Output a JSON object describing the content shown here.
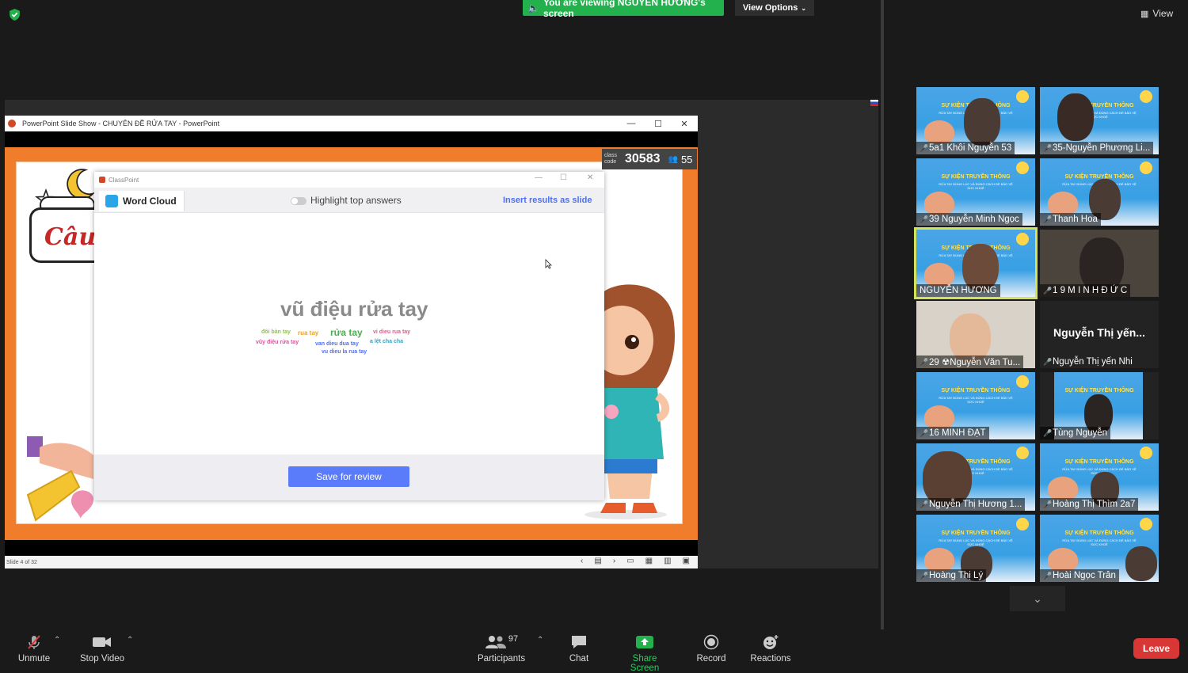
{
  "top": {
    "viewing_text": "You are viewing NGUYỄN HƯƠNG's screen",
    "view_options": "View Options",
    "view": "View"
  },
  "ppt": {
    "window_title": "PowerPoint Slide Show  -  CHUYÊN ĐỀ RỬA TAY - PowerPoint",
    "status": "Slide 4 of 32",
    "class_code_label": "class code",
    "class_code": "30583",
    "participants": "55",
    "slide_title": "Câu"
  },
  "classpoint": {
    "window_title": "ClassPoint",
    "tab": "Word Cloud",
    "highlight_label": "Highlight top answers",
    "insert_label": "Insert results as slide",
    "main_word": "vũ điệu rửa tay",
    "words": [
      {
        "text": "đôi bàn tay",
        "color": "#8cc63f"
      },
      {
        "text": "rua tay",
        "color": "#f0a020"
      },
      {
        "text": "rửa tay",
        "color": "#4caf50"
      },
      {
        "text": "vi dieu rua tay",
        "color": "#e05a8a"
      },
      {
        "text": "vũy điệu rửa tay",
        "color": "#d9539b"
      },
      {
        "text": "van dieu dua tay",
        "color": "#4d6ff5"
      },
      {
        "text": "a lệt cha cha",
        "color": "#2aa6c8"
      },
      {
        "text": "vu dieu la rua tay",
        "color": "#4d6ff5"
      }
    ],
    "save_label": "Save for review"
  },
  "gallery": [
    {
      "name": "5a1 Khôi Nguyễn 53",
      "type": "banner"
    },
    {
      "name": "35-Nguyễn Phương Li...",
      "type": "banner"
    },
    {
      "name": "39 Nguyễn Minh Ngọc",
      "type": "banner"
    },
    {
      "name": "Thanh Hoa",
      "type": "banner"
    },
    {
      "name": "NGUYỄN HƯƠNG",
      "type": "banner"
    },
    {
      "name": "1 9 M I N H Đ Ứ C",
      "type": "dark-photo"
    },
    {
      "name": "29 ☢Nguyễn Văn Tu...",
      "type": "photo"
    },
    {
      "name": "Nguyễn Thị yến Nhi",
      "big": "Nguyễn Thị yến...",
      "type": "dark"
    },
    {
      "name": "16 MINH ĐẠT",
      "type": "banner"
    },
    {
      "name": "Tùng Nguyễn",
      "type": "banner"
    },
    {
      "name": "Nguyễn Thị Hương 1...",
      "type": "banner"
    },
    {
      "name": "Hoàng Thị Thìm 2a7",
      "type": "banner"
    },
    {
      "name": "Hoàng Thị Lý",
      "type": "banner"
    },
    {
      "name": "Hoài Ngọc Trân",
      "type": "banner"
    }
  ],
  "banner_text": {
    "title": "SỰ KIỆN TRUYỀN THÔNG",
    "subtitle": "RỬA TAY ĐÚNG LÚC VÀ ĐÚNG CÁCH ĐỂ BẢO VỆ SỨC KHOẺ"
  },
  "toolbar": {
    "unmute": "Unmute",
    "stop_video": "Stop Video",
    "participants": "Participants",
    "participants_count": "97",
    "chat": "Chat",
    "share_screen": "Share Screen",
    "record": "Record",
    "reactions": "Reactions",
    "leave": "Leave"
  },
  "colors": {
    "green": "#23b14d",
    "leave": "#d93636",
    "accent": "#5b7cfa",
    "slide_orange": "#ef7d2b"
  }
}
